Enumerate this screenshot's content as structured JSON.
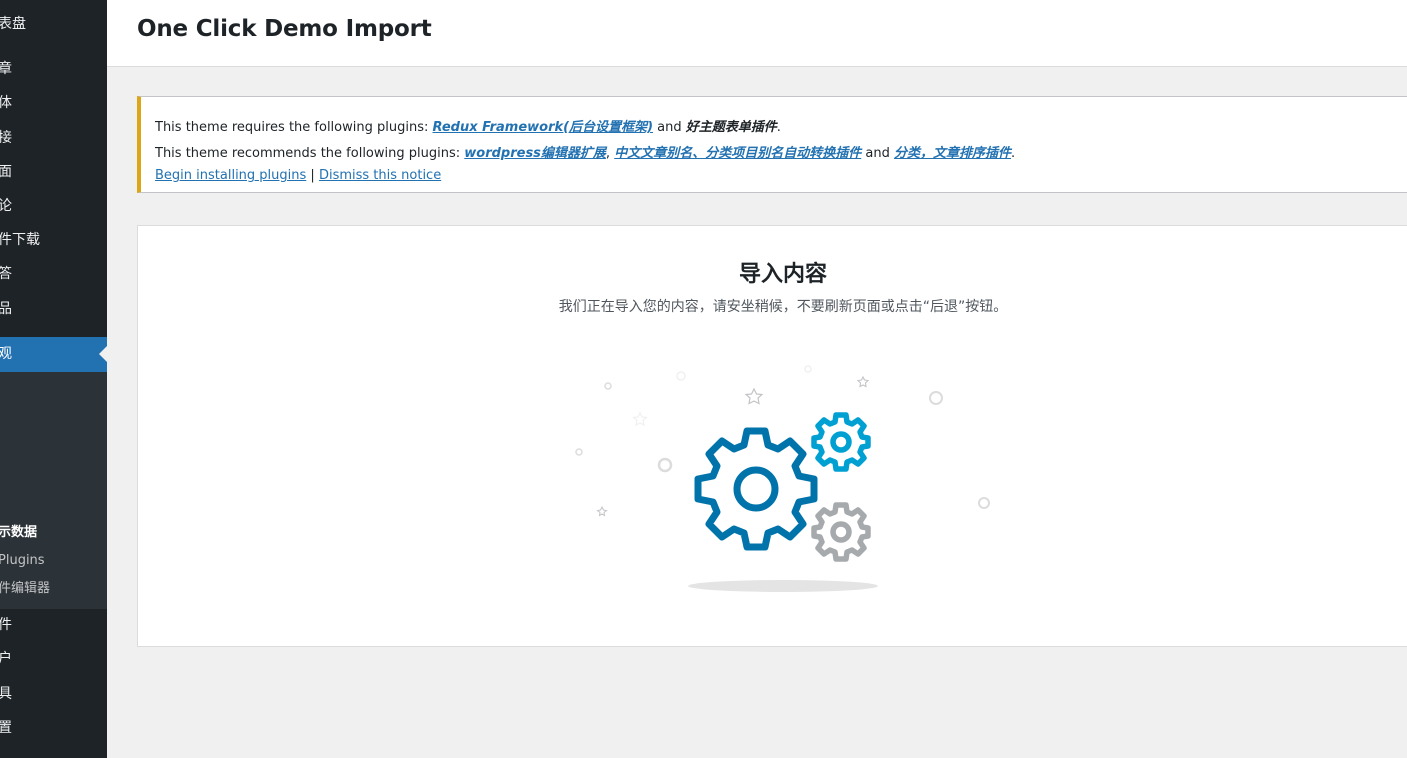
{
  "sidebar": {
    "items": [
      {
        "label": "表盘"
      },
      {
        "label": "章"
      },
      {
        "label": "体"
      },
      {
        "label": "接"
      },
      {
        "label": "面"
      },
      {
        "label": "论"
      },
      {
        "label": "件下载"
      },
      {
        "label": "答"
      },
      {
        "label": "品"
      }
    ],
    "active": {
      "label": "观"
    },
    "submenu": [
      {
        "label": "示数据"
      },
      {
        "label": "Plugins"
      },
      {
        "label": "件编辑器"
      }
    ],
    "bottom_items": [
      {
        "label": "件"
      },
      {
        "label": "户"
      },
      {
        "label": "具"
      },
      {
        "label": "置"
      }
    ]
  },
  "header": {
    "title": "One Click Demo Import"
  },
  "notice": {
    "line1_prefix": "This theme requires the following plugins:",
    "line1_link": "Redux Framework(后台设置框架)",
    "line1_and": "and",
    "line1_plugin2": "好主题表单插件",
    "line1_end": ".",
    "line2_prefix": "This theme recommends the following plugins:",
    "line2_link1": "wordpress编辑器扩展",
    "line2_comma": ",",
    "line2_link2": "中文文章别名、分类项目别名自动转换插件",
    "line2_and": "and",
    "line2_link3": "分类，文章排序插件",
    "line2_end": ".",
    "begin_link": "Begin installing plugins",
    "separator": "|",
    "dismiss_link": "Dismiss this notice"
  },
  "import": {
    "title": "导入内容",
    "description": "我们正在导入您的内容，请安坐稍候，不要刷新页面或点击“后退”按钮。"
  },
  "colors": {
    "sidebar_bg": "#1d2327",
    "active_bg": "#2271b1",
    "notice_border": "#dba617",
    "gear_dark": "#0073aa",
    "gear_light": "#00a0d2",
    "gear_gray": "#a7aaad"
  }
}
